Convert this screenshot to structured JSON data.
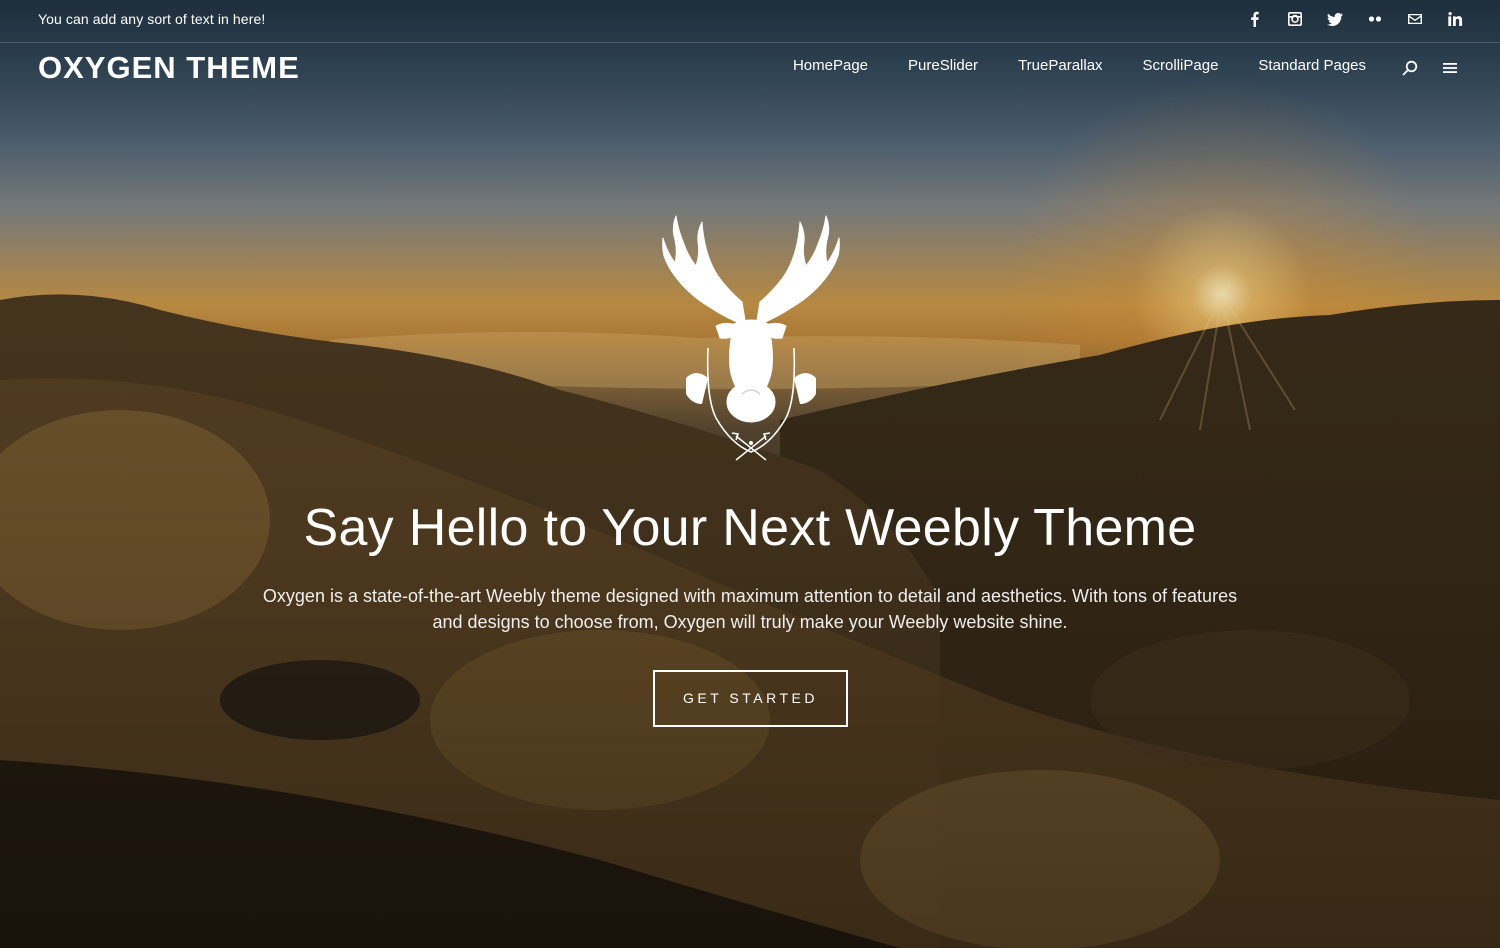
{
  "topbar": {
    "text": "You can add any sort of text in here!",
    "social": [
      "facebook-icon",
      "instagram-icon",
      "twitter-icon",
      "flickr-icon",
      "mail-icon",
      "linkedin-icon"
    ]
  },
  "header": {
    "logo": "OXYGEN THEME",
    "nav": [
      {
        "label": "HomePage"
      },
      {
        "label": "PureSlider"
      },
      {
        "label": "TrueParallax"
      },
      {
        "label": "ScrolliPage"
      },
      {
        "label": "Standard Pages"
      }
    ],
    "icons": [
      "search-icon",
      "menu-icon"
    ]
  },
  "hero": {
    "emblem": "stag-emblem-icon",
    "title": "Say Hello to Your Next Weebly Theme",
    "description": "Oxygen is a state-of-the-art Weebly theme designed with maximum attention to detail and aesthetics. With tons of features and designs to choose from, Oxygen will truly make your Weebly website shine.",
    "cta_label": "GET STARTED"
  },
  "colors": {
    "text": "#ffffff",
    "sky_top": "#2a3d4c",
    "horizon": "#c69445",
    "ground": "#1c1710"
  }
}
